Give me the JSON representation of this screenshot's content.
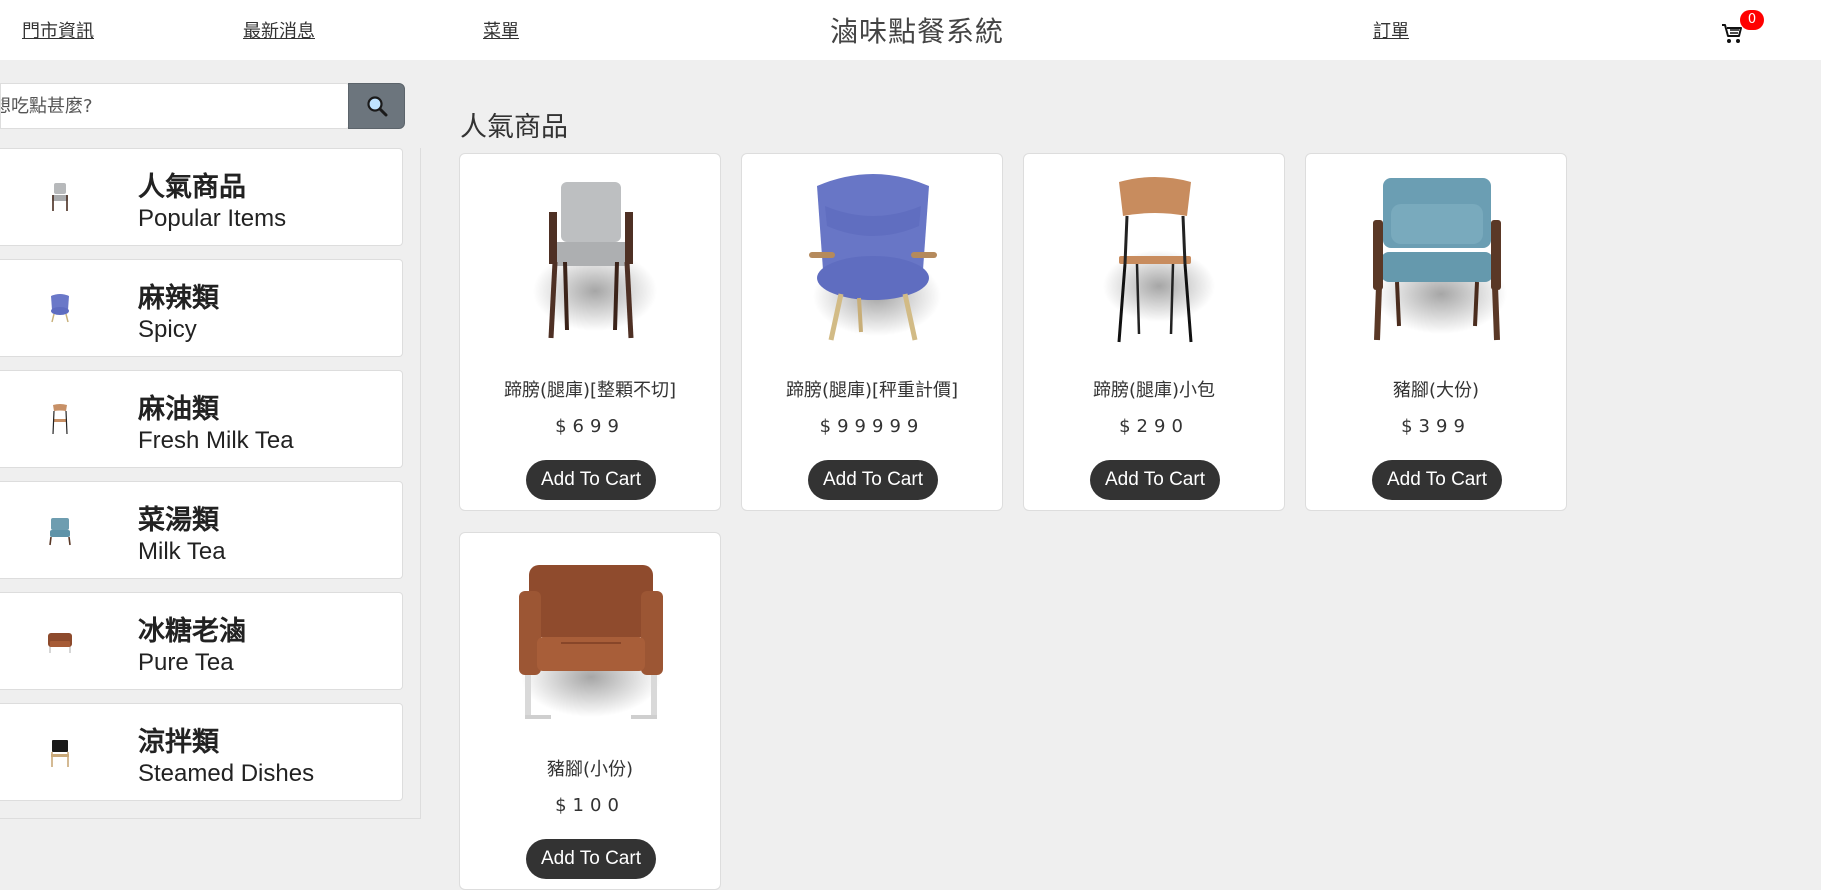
{
  "header": {
    "nav": [
      "門市資訊",
      "最新消息",
      "菜單"
    ],
    "title": "滷味點餐系統",
    "orders_label": "訂單",
    "cart_count": "0"
  },
  "search": {
    "placeholder": "想吃點甚麼?"
  },
  "categories": [
    {
      "zh": "人氣商品",
      "en": "Popular Items"
    },
    {
      "zh": "麻辣類",
      "en": "Spicy"
    },
    {
      "zh": "麻油類",
      "en": "Fresh Milk Tea"
    },
    {
      "zh": "菜湯類",
      "en": "Milk Tea"
    },
    {
      "zh": "冰糖老滷",
      "en": "Pure Tea"
    },
    {
      "zh": "涼拌類",
      "en": "Steamed Dishes"
    }
  ],
  "main": {
    "section_title": "人氣商品",
    "add_label": "Add To Cart",
    "products": [
      {
        "name": "蹄膀(腿庫)[整顆不切]",
        "price": "$699"
      },
      {
        "name": "蹄膀(腿庫)[秤重計價]",
        "price": "$99999"
      },
      {
        "name": "蹄膀(腿庫)小包",
        "price": "$290"
      },
      {
        "name": "豬腳(大份)",
        "price": "$399"
      },
      {
        "name": "豬腳(小份)",
        "price": "$100"
      }
    ]
  },
  "colors": {
    "badge": "#ff0000",
    "button_dark": "#333333",
    "search_button": "#6c757d",
    "background": "#efefef"
  }
}
